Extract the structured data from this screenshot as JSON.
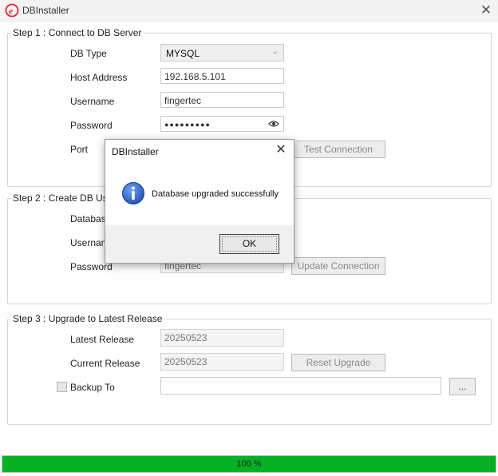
{
  "window": {
    "title": "DBInstaller",
    "close_glyph": "✕"
  },
  "step1": {
    "legend": "Step 1 : Connect to DB Server",
    "db_type_label": "DB Type",
    "db_type_value": "MYSQL",
    "host_label": "Host Address",
    "host_value": "192.168.5.101",
    "username_label": "Username",
    "username_value": "fingertec",
    "password_label": "Password",
    "password_value": "●●●●●●●●●",
    "port_label": "Port",
    "test_button": "Test Connection"
  },
  "step2": {
    "legend": "Step 2 : Create DB User",
    "database_label": "Database",
    "username_label": "Username",
    "password_label": "Password",
    "password_value": "fingertec",
    "update_button": "Update Connection"
  },
  "step3": {
    "legend": "Step 3 : Upgrade to Latest Release",
    "latest_label": "Latest Release",
    "latest_value": "20250523",
    "current_label": "Current Release",
    "current_value": "20250523",
    "reset_button": "Reset Upgrade",
    "backup_label": "Backup To",
    "backup_value": "",
    "browse_button": "..."
  },
  "progress": {
    "value": 100,
    "text": "100 %"
  },
  "dialog": {
    "title": "DBInstaller",
    "message": "Database upgraded successfully",
    "ok_label": "OK",
    "close_glyph": "✕",
    "icon": "info-icon"
  },
  "colors": {
    "progress": "#06b025",
    "info_icon": "#1e5bc6",
    "logo": "#e0282e"
  }
}
